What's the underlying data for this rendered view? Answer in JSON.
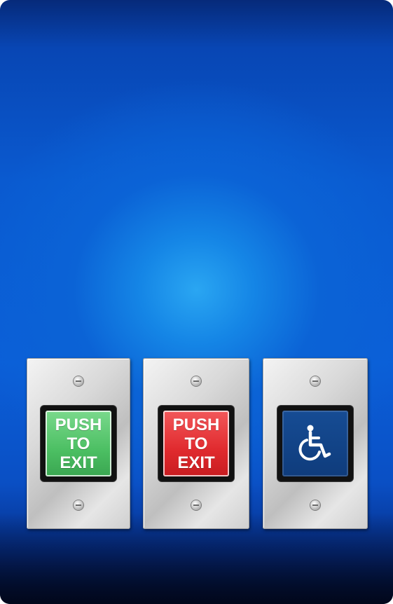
{
  "buttons": [
    {
      "lines": [
        "PUSH",
        "TO",
        "EXIT"
      ],
      "color": "#4cbf63",
      "icon": ""
    },
    {
      "lines": [
        "PUSH",
        "TO",
        "EXIT"
      ],
      "color": "#e02a2e",
      "icon": ""
    },
    {
      "lines": [],
      "color": "#0f3c7c",
      "icon": "wheelchair-icon"
    }
  ],
  "background": {
    "top": "#062a7a",
    "center": "#2aa6f2",
    "bottom": "#03143c"
  }
}
